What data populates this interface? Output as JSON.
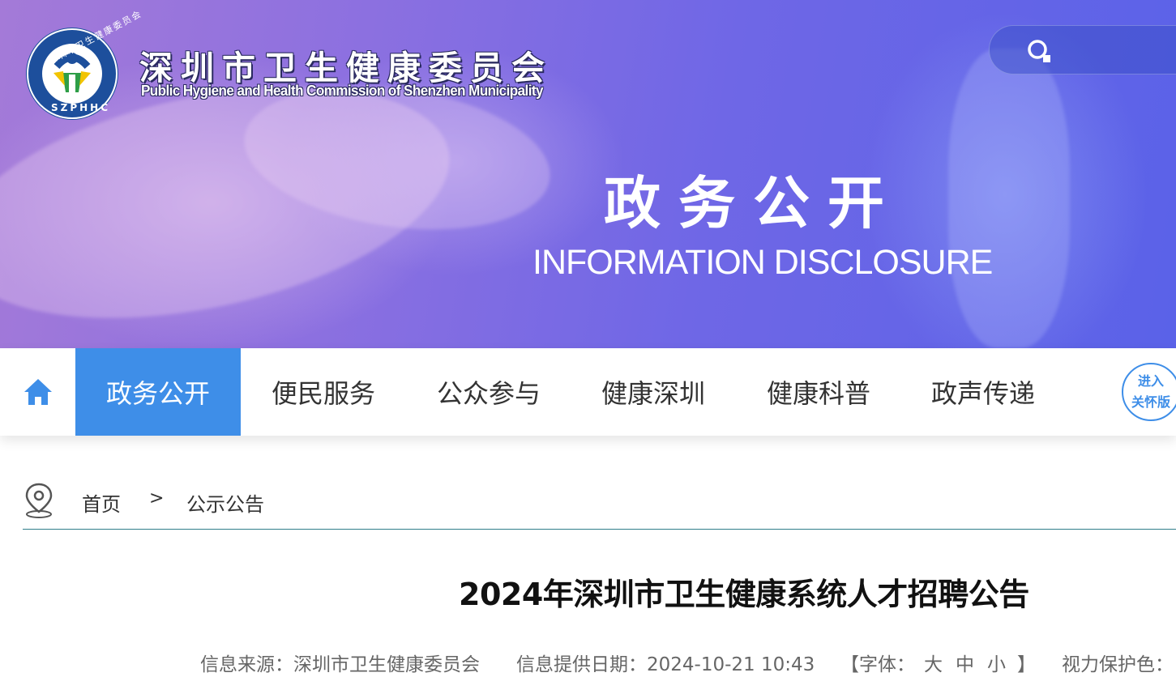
{
  "header": {
    "org_name_cn": "深圳市卫生健康委员会",
    "org_name_en": "Public Hygiene and Health Commission of Shenzhen Municipality",
    "logo_ring_text": "深圳市卫生健康委员会",
    "logo_ring_abbr": "SZPHHC",
    "search_icon": "search-icon"
  },
  "banner": {
    "title": "政务公开",
    "subtitle": "INFORMATION DISCLOSURE"
  },
  "nav": {
    "home_icon": "home-icon",
    "items": [
      {
        "label": "政务公开",
        "active": true
      },
      {
        "label": "便民服务",
        "active": false
      },
      {
        "label": "公众参与",
        "active": false
      },
      {
        "label": "健康深圳",
        "active": false
      },
      {
        "label": "健康科普",
        "active": false
      },
      {
        "label": "政声传递",
        "active": false
      }
    ],
    "care_mode": {
      "line1": "进入",
      "line2": "关怀版"
    }
  },
  "breadcrumb": {
    "icon": "location-pin-icon",
    "home": "首页",
    "separator": ">",
    "current": "公示公告"
  },
  "article": {
    "title": "2024年深圳市卫生健康系统人才招聘公告",
    "source_label": "信息来源：深圳市卫生健康委员会",
    "date_label": "信息提供日期：2024-10-21 10:43",
    "font_open": "【字体：",
    "font_large": "大",
    "font_medium": "中",
    "font_small": "小",
    "font_close": "】",
    "eye_care_label": "视力保护色："
  },
  "colors": {
    "accent": "#3e8ee8",
    "banner_start": "#a47ad8",
    "banner_end": "#5a62e8",
    "divider": "#2f7f8a"
  }
}
